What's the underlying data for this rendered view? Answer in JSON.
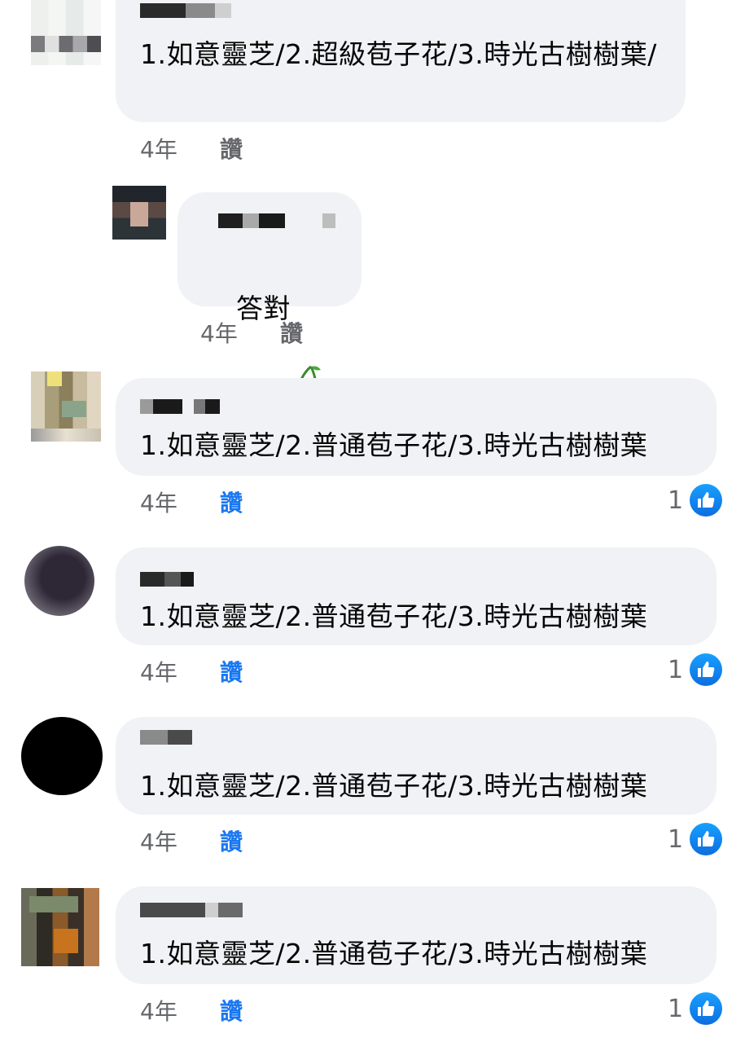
{
  "comments": [
    {
      "text": "1.如意靈芝/2.超級苞子花/3.時光古樹樹葉/",
      "time": "4年",
      "like_label": "讚",
      "like_active": false,
      "reactions": null
    },
    {
      "reply": true,
      "text": "答對",
      "emoji": "cherries",
      "time": "4年",
      "like_label": "讚",
      "like_active": false,
      "reactions": null
    },
    {
      "text": "1.如意靈芝/2.普通苞子花/3.時光古樹樹葉",
      "time": "4年",
      "like_label": "讚",
      "like_active": true,
      "reactions": "1"
    },
    {
      "text": "1.如意靈芝/2.普通苞子花/3.時光古樹樹葉",
      "time": "4年",
      "like_label": "讚",
      "like_active": true,
      "reactions": "1"
    },
    {
      "text": "1.如意靈芝/2.普通苞子花/3.時光古樹樹葉",
      "time": "4年",
      "like_label": "讚",
      "like_active": true,
      "reactions": "1"
    },
    {
      "text": "1.如意靈芝/2.普通苞子花/3.時光古樹樹葉",
      "time": "4年",
      "like_label": "讚",
      "like_active": true,
      "reactions": "1"
    }
  ],
  "colors": {
    "bubble": "#f0f2f5",
    "like_blue": "#1877f2",
    "meta_gray": "#65676b"
  }
}
